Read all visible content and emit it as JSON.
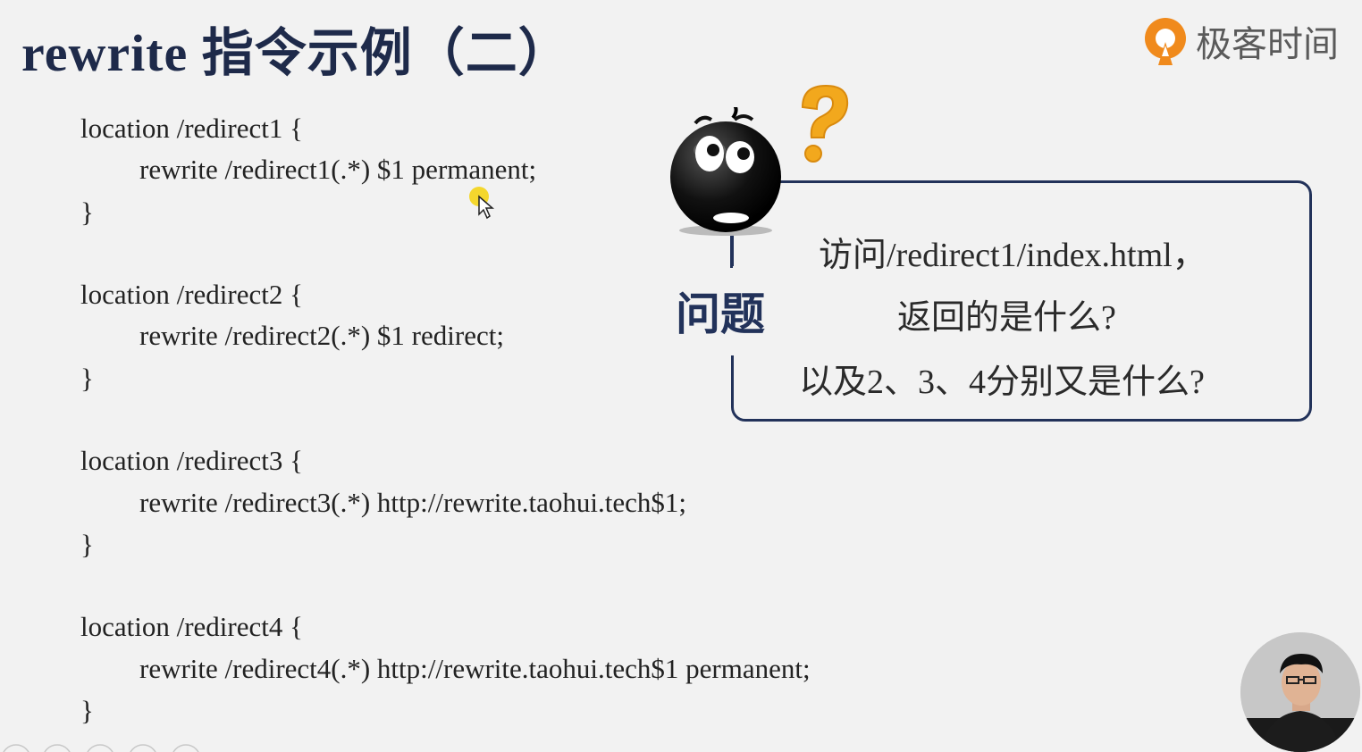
{
  "slide": {
    "title": "rewrite 指令示例（二）",
    "brand_name": "极客时间"
  },
  "code_lines": [
    "location /redirect1 {",
    "rewrite /redirect1(.*) $1 permanent;",
    "}",
    "location /redirect2 {",
    "rewrite /redirect2(.*) $1 redirect;",
    "}",
    "location /redirect3 {",
    "rewrite /redirect3(.*) http://rewrite.taohui.tech$1;",
    "}",
    "location /redirect4 {",
    "rewrite /redirect4(.*) http://rewrite.taohui.tech$1 permanent;",
    "}"
  ],
  "question": {
    "label": "问题",
    "line1": "访问/redirect1/index.html，",
    "line2": "返回的是什么?",
    "line3": "以及2、3、4分别又是什么?"
  },
  "colors": {
    "title": "#1e2a4a",
    "accent_navy": "#22325a",
    "brand_orange": "#f08a1c",
    "question_mark": "#f2a81d",
    "background": "#f2f2f2"
  },
  "icons": {
    "brand": "geektime-logo-icon",
    "thinking": "thinking-face-icon",
    "question": "question-mark-icon",
    "cursor": "mouse-cursor-icon"
  }
}
